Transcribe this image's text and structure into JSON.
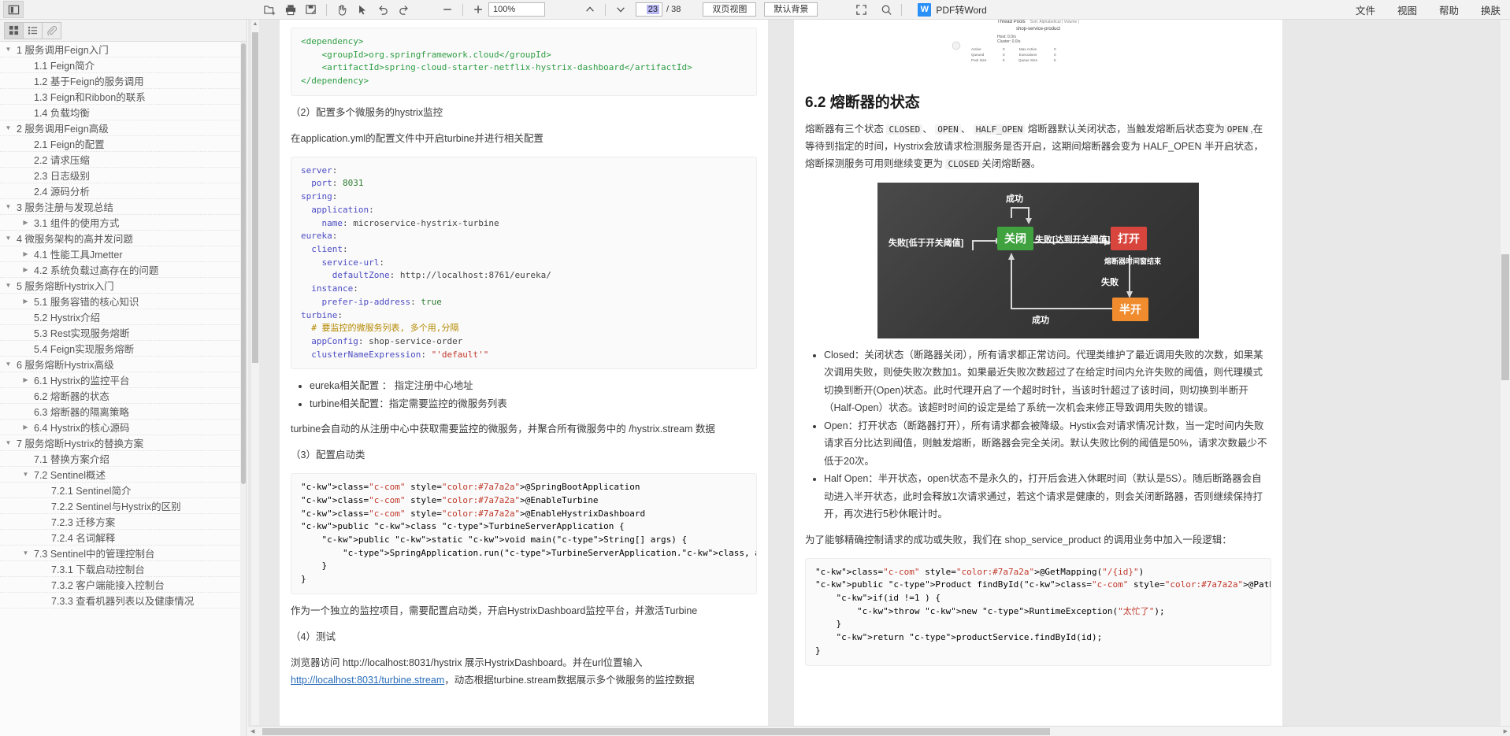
{
  "toolbar": {
    "sidebar_toggle": "sidebar-panel-toggle",
    "open_label": "open-file",
    "print_label": "print",
    "save_label": "save-as",
    "hand_label": "hand-tool",
    "select_label": "select-tool",
    "undo_label": "undo",
    "redo_label": "redo",
    "zoom_out": "−",
    "zoom_in": "+",
    "zoom_value": "100%",
    "prev_page": "prev-page",
    "next_page": "next-page",
    "current_page": "23",
    "page_separator": "/ 38",
    "view_mode": "双页视图",
    "background_mode": "默认背景",
    "fullscreen": "fullscreen",
    "search": "search",
    "pdf_to_word": "PDF转Word",
    "logo_letter": "W",
    "menus": [
      "文件",
      "视图",
      "帮助",
      "换肤"
    ]
  },
  "sidebar": {
    "tabs": [
      {
        "name": "thumbnails",
        "icon": "grid-icon"
      },
      {
        "name": "outline",
        "icon": "list-icon"
      },
      {
        "name": "attachments",
        "icon": "paperclip-icon"
      }
    ],
    "items": [
      {
        "label": "1 服务调用Feign入门",
        "level": 0,
        "arrow": "▼"
      },
      {
        "label": "1.1 Feign简介",
        "level": 1,
        "arrow": ""
      },
      {
        "label": "1.2 基于Feign的服务调用",
        "level": 1,
        "arrow": ""
      },
      {
        "label": "1.3 Feign和Ribbon的联系",
        "level": 1,
        "arrow": ""
      },
      {
        "label": "1.4 负载均衡",
        "level": 1,
        "arrow": ""
      },
      {
        "label": "2 服务调用Feign高级",
        "level": 0,
        "arrow": "▼"
      },
      {
        "label": "2.1 Feign的配置",
        "level": 1,
        "arrow": ""
      },
      {
        "label": "2.2 请求压缩",
        "level": 1,
        "arrow": ""
      },
      {
        "label": "2.3 日志级别",
        "level": 1,
        "arrow": ""
      },
      {
        "label": "2.4 源码分析",
        "level": 1,
        "arrow": ""
      },
      {
        "label": "3 服务注册与发现总结",
        "level": 0,
        "arrow": "▼"
      },
      {
        "label": "3.1 组件的使用方式",
        "level": 1,
        "arrow": "▶"
      },
      {
        "label": "4 微服务架构的高并发问题",
        "level": 0,
        "arrow": "▼"
      },
      {
        "label": "4.1 性能工具Jmetter",
        "level": 1,
        "arrow": "▶"
      },
      {
        "label": "4.2 系统负载过高存在的问题",
        "level": 1,
        "arrow": "▶"
      },
      {
        "label": "5 服务熔断Hystrix入门",
        "level": 0,
        "arrow": "▼"
      },
      {
        "label": "5.1 服务容错的核心知识",
        "level": 1,
        "arrow": "▶"
      },
      {
        "label": "5.2 Hystrix介绍",
        "level": 1,
        "arrow": ""
      },
      {
        "label": "5.3 Rest实现服务熔断",
        "level": 1,
        "arrow": ""
      },
      {
        "label": "5.4 Feign实现服务熔断",
        "level": 1,
        "arrow": ""
      },
      {
        "label": "6 服务熔断Hystrix高级",
        "level": 0,
        "arrow": "▼"
      },
      {
        "label": "6.1 Hystrix的监控平台",
        "level": 1,
        "arrow": "▶"
      },
      {
        "label": "6.2 熔断器的状态",
        "level": 1,
        "arrow": ""
      },
      {
        "label": "6.3 熔断器的隔离策略",
        "level": 1,
        "arrow": ""
      },
      {
        "label": "6.4 Hystrix的核心源码",
        "level": 1,
        "arrow": "▶"
      },
      {
        "label": "7 服务熔断Hystrix的替换方案",
        "level": 0,
        "arrow": "▼"
      },
      {
        "label": "7.1 替换方案介绍",
        "level": 1,
        "arrow": ""
      },
      {
        "label": "7.2 Sentinel概述",
        "level": 1,
        "arrow": "▼"
      },
      {
        "label": "7.2.1 Sentinel简介",
        "level": 2,
        "arrow": ""
      },
      {
        "label": "7.2.2 Sentinel与Hystrix的区别",
        "level": 2,
        "arrow": ""
      },
      {
        "label": "7.2.3 迁移方案",
        "level": 2,
        "arrow": ""
      },
      {
        "label": "7.2.4 名词解释",
        "level": 2,
        "arrow": ""
      },
      {
        "label": "7.3 Sentinel中的管理控制台",
        "level": 1,
        "arrow": "▼"
      },
      {
        "label": "7.3.1 下载启动控制台",
        "level": 2,
        "arrow": ""
      },
      {
        "label": "7.3.2 客户端能接入控制台",
        "level": 2,
        "arrow": ""
      },
      {
        "label": "7.3.3 查看机器列表以及健康情况",
        "level": 2,
        "arrow": ""
      }
    ]
  },
  "left_page": {
    "code1_lines": [
      "<dependency>",
      "    <groupId>org.springframework.cloud</groupId>",
      "    <artifactId>spring-cloud-starter-netflix-hystrix-dashboard</artifactId>",
      "</dependency>"
    ],
    "heading2": "（2）配置多个微服务的hystrix监控",
    "para1": "在application.yml的配置文件中开启turbine并进行相关配置",
    "code2": "server:\n  port: 8031\nspring:\n  application:\n    name: microservice-hystrix-turbine\neureka:\n  client:\n    service-url:\n      defaultZone: http://localhost:8761/eureka/\n  instance:\n    prefer-ip-address: true\nturbine:\n  # 要监控的微服务列表, 多个用,分隔\n  appConfig: shop-service-order\n  clusterNameExpression: \"'default'\"",
    "bullets": [
      "eureka相关配置 ： 指定注册中心地址",
      "turbine相关配置：指定需要监控的微服务列表"
    ],
    "para2": "turbine会自动的从注册中心中获取需要监控的微服务，并聚合所有微服务中的 /hystrix.stream 数据",
    "heading3": "（3）配置启动类",
    "code3": "@SpringBootApplication\n@EnableTurbine\n@EnableHystrixDashboard\npublic class TurbineServerApplication {\n    public static void main(String[] args) {\n        SpringApplication.run(TurbineServerApplication.class, args);\n    }\n}",
    "para3": "作为一个独立的监控项目，需要配置启动类，开启HystrixDashboard监控平台，并激活Turbine",
    "heading4": "（4）测试",
    "para4_prefix": "浏览器访问 http://localhost:8031/hystrix 展示HystrixDashboard。并在url位置输入 ",
    "para4_link": "http://localhost:8031/turbine.stream",
    "para4_suffix": "，动态根据turbine.stream数据展示多个微服务的监控数据"
  },
  "right_page": {
    "mini_dash": {
      "title": "Thread Pools",
      "sort_label": "Sort: Alphabetical | Volume |",
      "service": "shop-service-product",
      "host": "Host: 0.0/s",
      "cluster": "Cluster: 0.0/s",
      "cols": [
        "Active",
        "Queued",
        "Pool Size"
      ],
      "vals": [
        "0",
        "0",
        "5"
      ],
      "cols2": [
        "Max Active",
        "Executions",
        "Queue Size"
      ],
      "vals2": [
        "0",
        "0",
        "5"
      ]
    },
    "heading": "6.2 熔断器的状态",
    "para1_a": "熔断器有三个状态 ",
    "code_closed": "CLOSED",
    "p_dun1": "、 ",
    "code_open": "OPEN",
    "p_dun2": "、 ",
    "code_half": "HALF_OPEN",
    "para1_b": " 熔断器默认关闭状态，当触发熔断后状态变为",
    "code_open2": "OPEN",
    "para1_c": ",在等待到指定的时间，Hystrix会放请求检测服务是否开启，这期间熔断器会变为 HALF_OPEN 半开启状态，熔断探测服务可用则继续变更为 ",
    "code_closed2": "CLOSED",
    "para1_d": "关闭熔断器。",
    "diagram": {
      "success_top": "成功",
      "fail_low": "失败[低于开关阈值]",
      "closed": "关闭",
      "fail_reach": "失败[达到开关阈值]",
      "open": "打开",
      "timer_end": "熔断器时间窗结束",
      "fail_right": "失败",
      "half_open": "半开",
      "success_bottom": "成功"
    },
    "bullets": [
      "Closed：关闭状态（断路器关闭），所有请求都正常访问。代理类维护了最近调用失败的次数，如果某次调用失败，则使失败次数加1。如果最近失败次数超过了在给定时间内允许失败的阈值，则代理模式切换到断开(Open)状态。此时代理开启了一个超时时针，当该时针超过了该时间，则切换到半断开（Half-Open）状态。该超时时间的设定是给了系统一次机会来修正导致调用失败的错误。",
      "Open：打开状态（断路器打开），所有请求都会被降级。Hystix会对请求情况计数，当一定时间内失败请求百分比达到阈值，则触发熔断，断路器会完全关闭。默认失败比例的阈值是50%，请求次数最少不低于20次。",
      "Half Open：半开状态，open状态不是永久的，打开后会进入休眠时间（默认是5S）。随后断路器会自动进入半开状态，此时会释放1次请求通过，若这个请求是健康的，则会关闭断路器，否则继续保持打开，再次进行5秒休眠计时。"
    ],
    "para2": "为了能够精确控制请求的成功或失败，我们在 shop_service_product 的调用业务中加入一段逻辑：",
    "code": "@GetMapping(\"/{id}\")\npublic Product findById(@PathVariable Long id) {\n    if(id !=1 ) {\n        throw new RuntimeException(\"太忙了\");\n    }\n    return productService.findById(id);\n}"
  }
}
